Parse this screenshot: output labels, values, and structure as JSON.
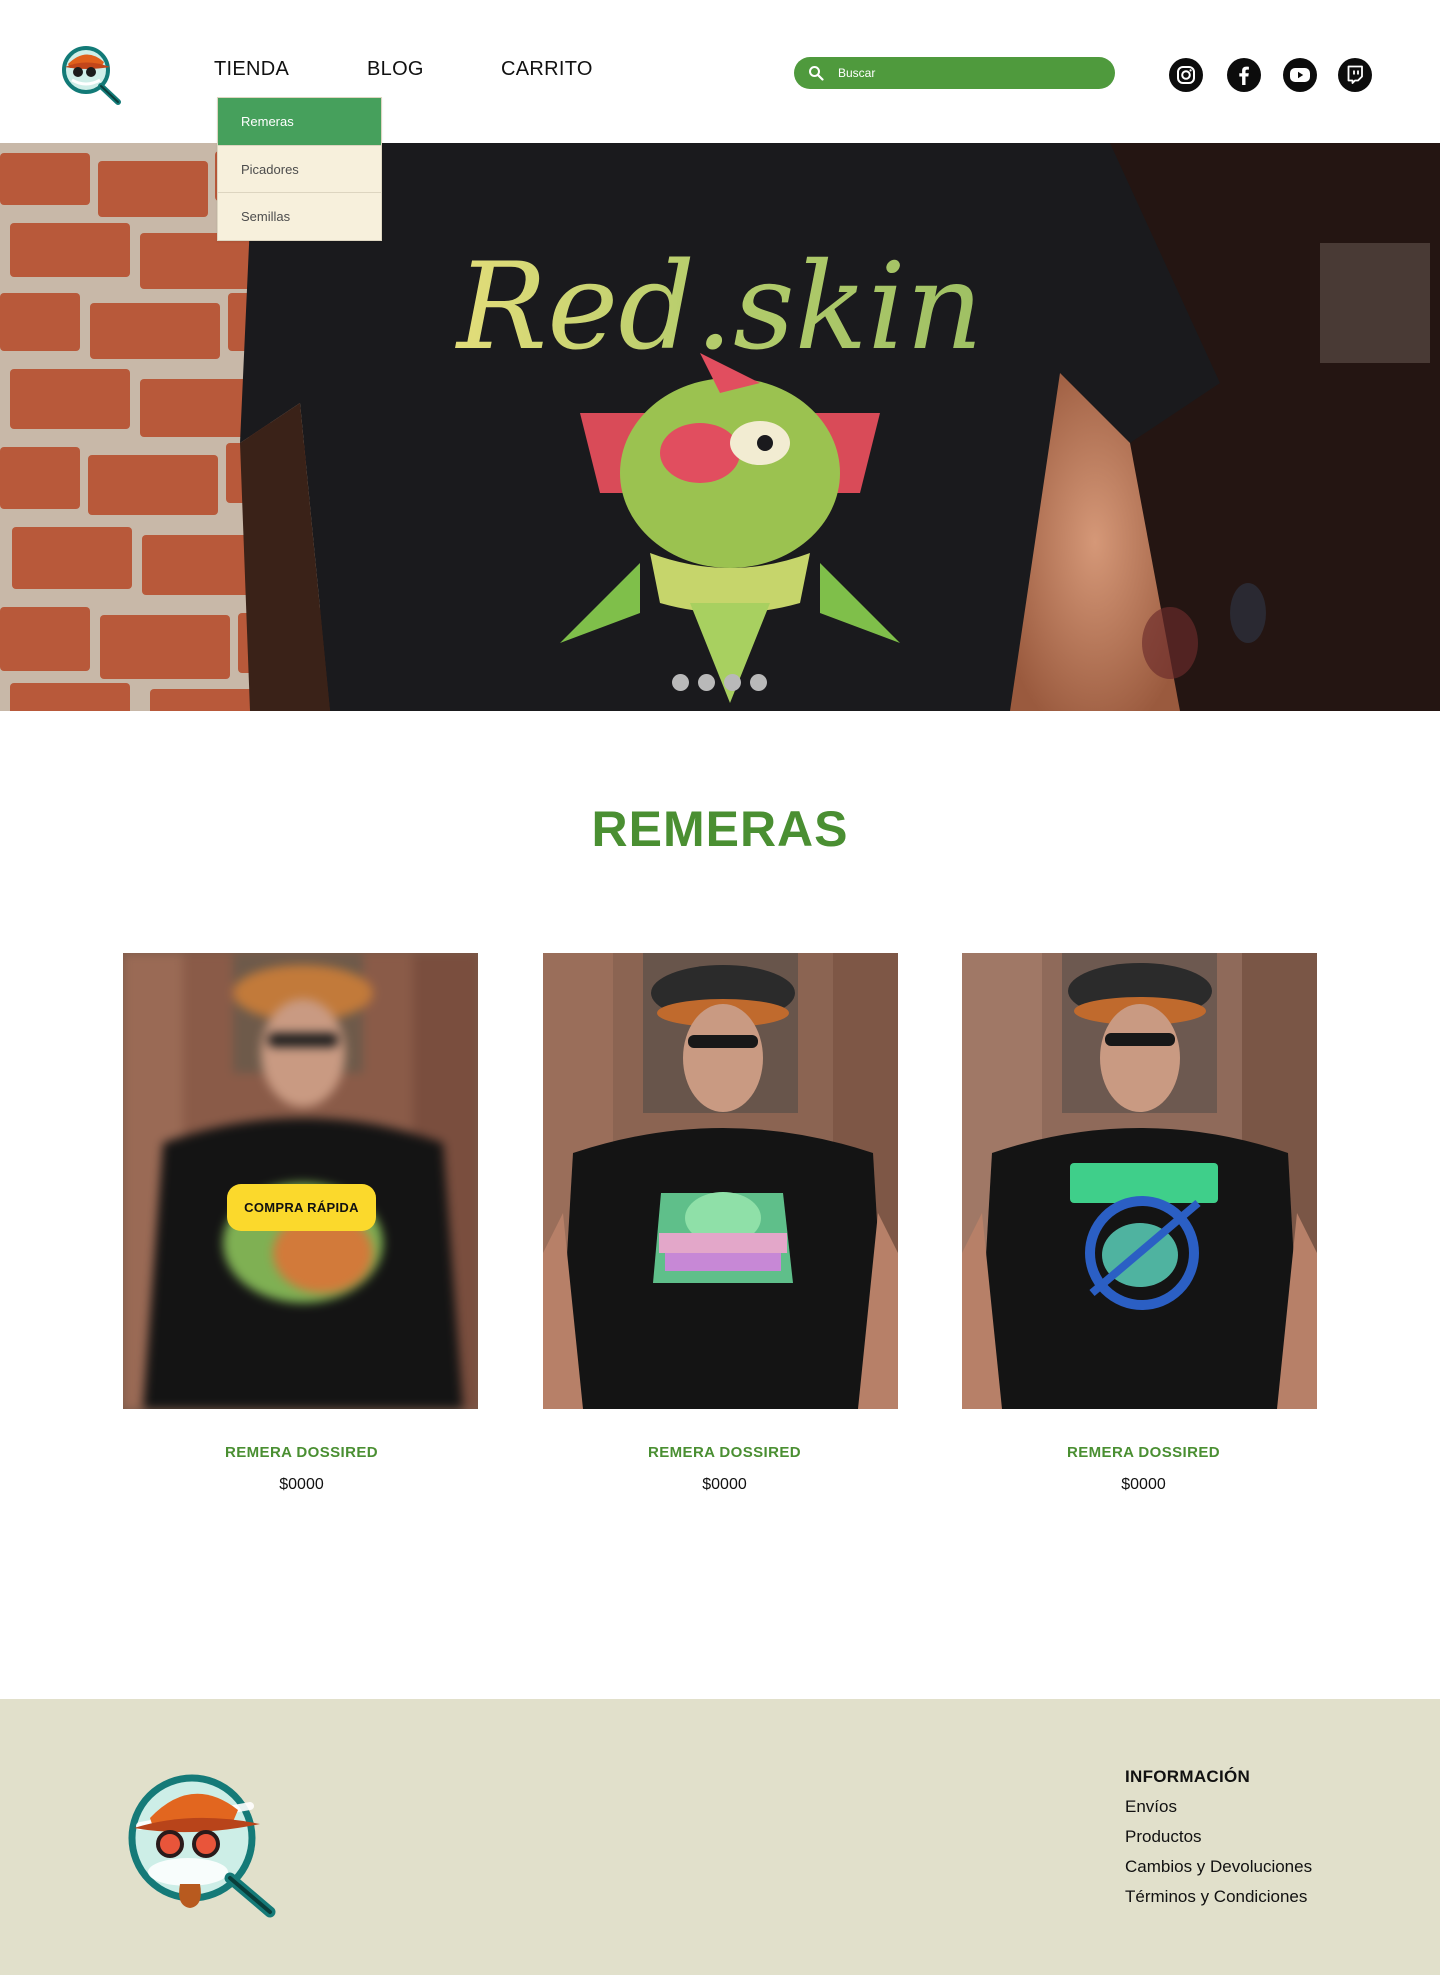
{
  "header": {
    "nav": [
      "TIENDA",
      "BLOG",
      "CARRITO"
    ],
    "search_placeholder": "Buscar",
    "social": [
      "instagram-icon",
      "facebook-icon",
      "youtube-icon",
      "twitch-icon"
    ]
  },
  "dropdown": {
    "items": [
      "Remeras",
      "Picadores",
      "Semillas"
    ],
    "active_index": 0
  },
  "hero": {
    "slide_count": 4
  },
  "section": {
    "title": "REMERAS"
  },
  "products": [
    {
      "name": "REMERA DOSSIRED",
      "price": "$0000",
      "quick_buy": "COMPRA RÁPIDA"
    },
    {
      "name": "REMERA DOSSIRED",
      "price": "$0000"
    },
    {
      "name": "REMERA DOSSIRED",
      "price": "$0000"
    }
  ],
  "footer": {
    "info_title": "INFORMACIÓN",
    "links": [
      "Envíos",
      "Productos",
      "Cambios y Devoluciones",
      "Términos y Condiciones"
    ]
  },
  "colors": {
    "brand_green": "#4a8f32",
    "search_green": "#4f9a3d",
    "dropdown_active": "#46a05c",
    "dropdown_bg": "#f7f0dc",
    "quick_buy_yellow": "#fbd92c",
    "footer_bg": "#e1e0cb"
  }
}
